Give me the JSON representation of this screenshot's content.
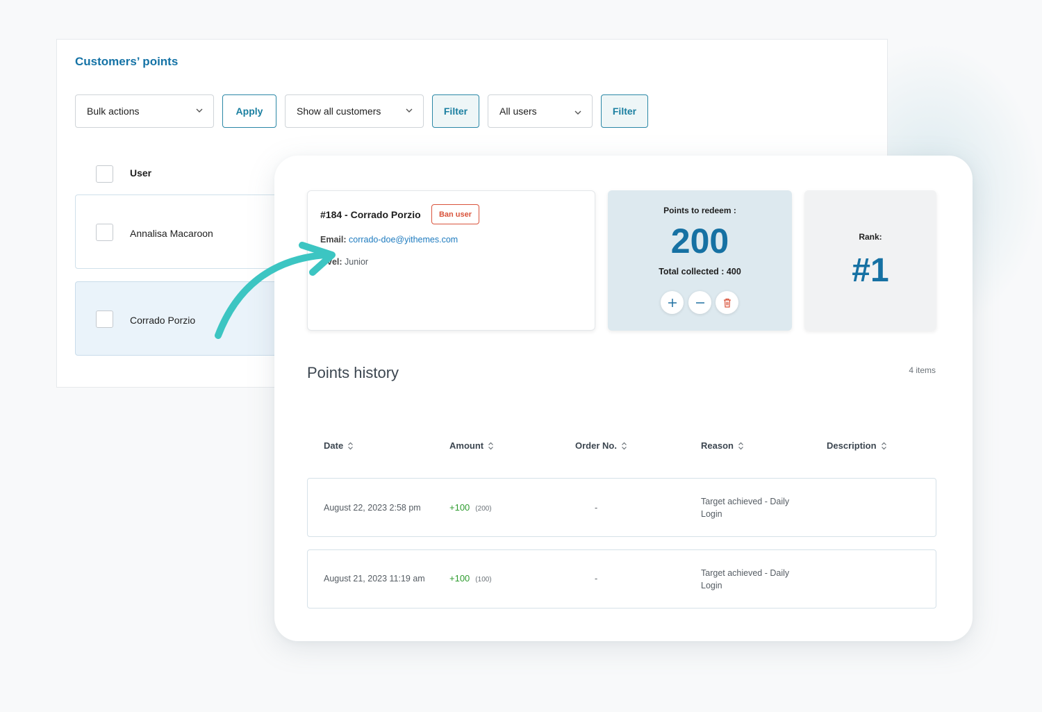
{
  "back_panel": {
    "title": "Customers’ points",
    "bulk_select": "Bulk actions",
    "apply_label": "Apply",
    "customers_select": "Show all customers",
    "filter1_label": "Filter",
    "users_select": "All users",
    "filter2_label": "Filter",
    "user_header": "User",
    "users": [
      {
        "name": "Annalisa Macaroon",
        "selected": false
      },
      {
        "name": "Corrado Porzio",
        "selected": true
      }
    ]
  },
  "customer": {
    "title": "#184 - Corrado Porzio",
    "ban_label": "Ban user",
    "email_label": "Email:",
    "email": "corrado-doe@yithemes.com",
    "level_label": "vel:",
    "level": "Junior"
  },
  "redeem": {
    "label": "Points to redeem :",
    "value": "200",
    "collected": "Total collected : 400"
  },
  "rank": {
    "label": "Rank:",
    "value": "#1"
  },
  "history": {
    "title": "Points history",
    "count": "4 items",
    "columns": [
      "Date",
      "Amount",
      "Order No.",
      "Reason",
      "Description"
    ],
    "rows": [
      {
        "date": "August 22, 2023 2:58 pm",
        "amount": "+100",
        "total": "(200)",
        "order": "-",
        "reason": "Target achieved - Daily Login"
      },
      {
        "date": "August 21, 2023 11:19 am",
        "amount": "+100",
        "total": "(100)",
        "order": "-",
        "reason": "Target achieved - Daily Login"
      }
    ]
  },
  "colors": {
    "accent": "#1671a3",
    "ban": "#d9533b",
    "positive": "#2d9b2e",
    "arrow": "#3cc5c2"
  }
}
